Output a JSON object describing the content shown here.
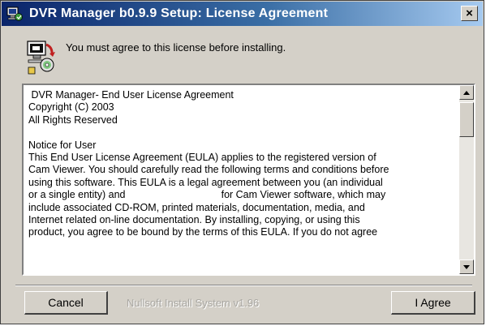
{
  "window": {
    "title": "DVR Manager b0.9.9 Setup: License Agreement",
    "close_glyph": "×",
    "title_icon": "installer-icon"
  },
  "header": {
    "icon": "license-document-icon",
    "text": "You must agree to this license before installing."
  },
  "license": {
    "lines": [
      " DVR Manager- End User License Agreement",
      "Copyright (C) 2003",
      "All Rights Reserved",
      "",
      "Notice for User",
      "This End User License Agreement (EULA) applies to the registered version of",
      "Cam Viewer. You should carefully read the following terms and conditions before",
      "using this software. This EULA is a legal agreement between you (an individual",
      "or a single entity) and                                  for Cam Viewer software, which may",
      "include associated CD-ROM, printed materials, documentation, media, and",
      "Internet related on-line documentation. By installing, copying, or using this",
      "product, you agree to be bound by the terms of this EULA. If you do not agree"
    ]
  },
  "scrollbar": {
    "up_icon": "scroll-up-arrow-icon",
    "down_icon": "scroll-down-arrow-icon"
  },
  "footer": {
    "cancel_label": "Cancel",
    "branding": "Nullsoft Install System v1.96",
    "agree_label": "I Agree"
  },
  "colors": {
    "titlebar_start": "#0a246a",
    "titlebar_end": "#a6caf0",
    "dialog_bg": "#d4d0c8"
  }
}
